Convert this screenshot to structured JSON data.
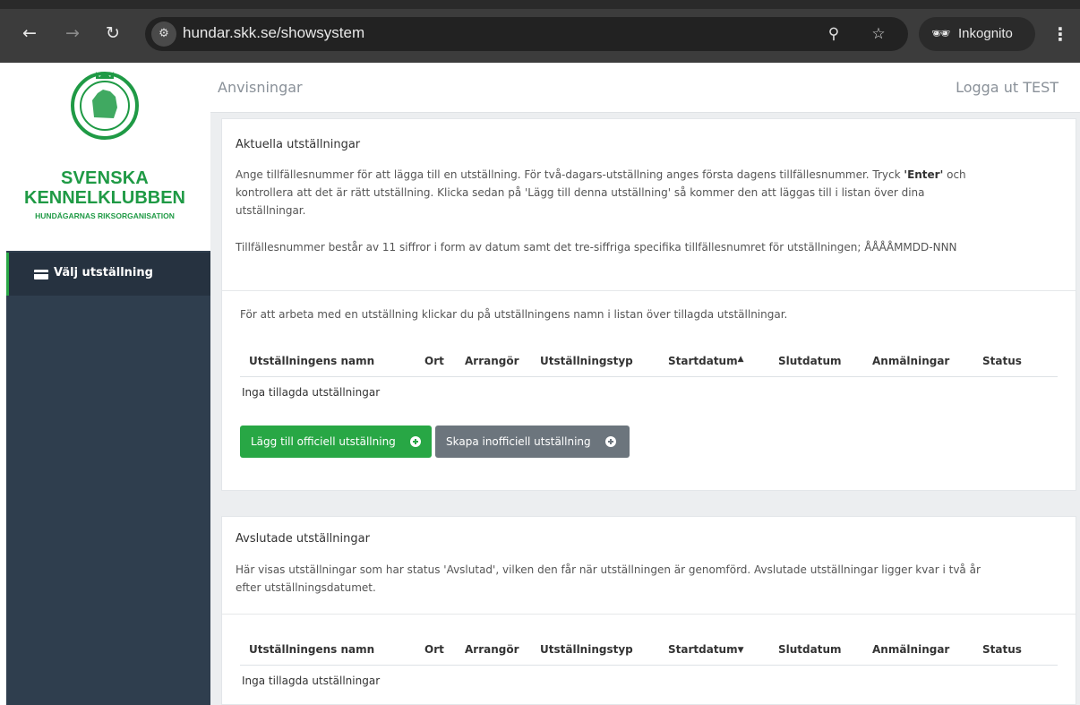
{
  "browser": {
    "url": "hundar.skk.se/showsystem",
    "incognito_label": "Inkognito"
  },
  "sidebar": {
    "brand_line1": "SVENSKA",
    "brand_line2": "KENNELKLUBBEN",
    "brand_sub": "HUNDÄGARNAS RIKSORGANISATION",
    "items": [
      {
        "label": "Välj utställning",
        "icon": "id-card-icon",
        "active": true
      }
    ],
    "accent_color": "#28a745"
  },
  "header": {
    "title": "Anvisningar",
    "logout": "Logga ut TEST"
  },
  "current_shows": {
    "title": "Aktuella utställningar",
    "intro_part1": "Ange tillfällesnummer för att lägga till en utställning. För två-dagars-utställning anges första dagens tillfällesnummer. Tryck ",
    "intro_bold": "'Enter'",
    "intro_part2": " och kontrollera att det är rätt utställning. Klicka sedan på 'Lägg till denna utställning' så kommer den att läggas till i listan över dina utställningar.",
    "format_note": "Tillfällesnummer består av 11 siffror i form av datum samt det tre-siffriga specifika tillfällesnumret för utställningen; ÅÅÅÅMMDD-NNN",
    "list_note": "För att arbeta med en utställning klickar du på utställningens namn i listan över tillagda utställningar.",
    "columns": [
      "Utställningens namn",
      "Ort",
      "Arrangör",
      "Utställningstyp",
      "Startdatum",
      "Slutdatum",
      "Anmälningar",
      "Status"
    ],
    "sort_indicator": "▲",
    "empty_text": "Inga tillagda utställningar",
    "add_official_button": "Lägg till officiell utställning",
    "create_unofficial_button": "Skapa inofficiell utställning"
  },
  "finished_shows": {
    "title": "Avslutade utställningar",
    "intro": "Här visas utställningar som har status 'Avslutad', vilken den får när utställningen är genomförd. Avslutade utställningar ligger kvar i två år efter utställningsdatumet.",
    "columns": [
      "Utställningens namn",
      "Ort",
      "Arrangör",
      "Utställningstyp",
      "Startdatum",
      "Slutdatum",
      "Anmälningar",
      "Status"
    ],
    "sort_indicator": "▼",
    "empty_text": "Inga tillagda utställningar"
  }
}
